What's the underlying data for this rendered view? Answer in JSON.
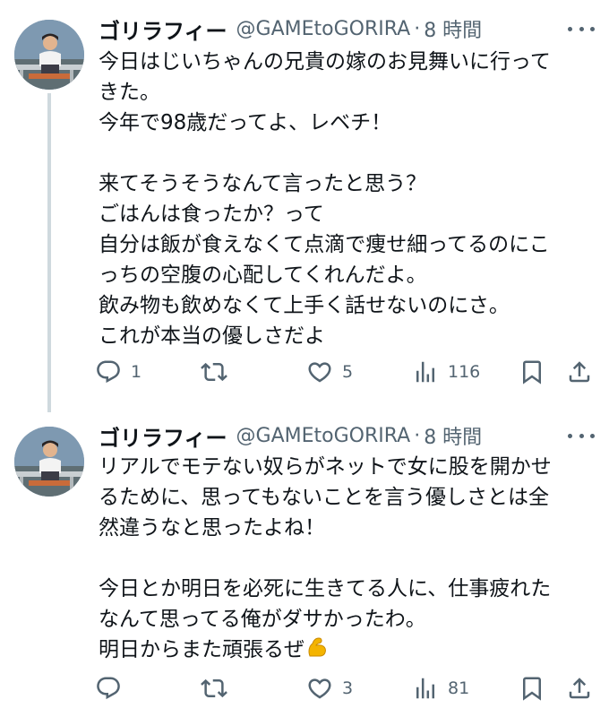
{
  "tweets": [
    {
      "author_name": "ゴリラフィー",
      "handle": "@GAMEtoGORIRA",
      "separator": "·",
      "time": "8 時間",
      "text": "今日はじいちゃんの兄貴の嫁のお見舞いに行って\nきた。\n今年で98歳だってよ、レベチ！\n\n来てそうそうなんて言ったと思う？\nごはんは食ったか？って\n自分は飯が食えなくて点滴で痩せ細ってるのにこ\nっちの空腹の心配してくれんだよ。\n飲み物も飲めなくて上手く話せないのにさ。\nこれが本当の優しさだよ",
      "replies": "1",
      "retweets": "",
      "likes": "5",
      "views": "116"
    },
    {
      "author_name": "ゴリラフィー",
      "handle": "@GAMEtoGORIRA",
      "separator": "·",
      "time": "8 時間",
      "text": "リアルでモテない奴らがネットで女に股を開かせ\nるために、思ってもないことを言う優しさとは全\n然違うなと思ったよね！\n\n今日とか明日を必死に生きてる人に、仕事疲れた\nなんて思ってる俺がダサかったわ。\n明日からまた頑張るぜ",
      "emoji": "flexed-biceps-icon",
      "replies": "",
      "retweets": "",
      "likes": "3",
      "views": "81"
    }
  ],
  "colors": {
    "text": "#0f1419",
    "secondary": "#536471",
    "thread_line": "#cfd9de",
    "emoji": "#f4b400"
  }
}
